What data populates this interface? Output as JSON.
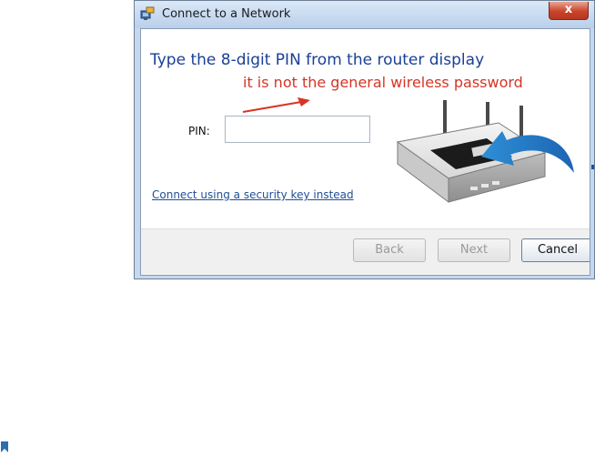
{
  "window": {
    "title": "Connect to a Network",
    "close_symbol": "x"
  },
  "content": {
    "heading": "Type the 8-digit PIN from the router display",
    "note": "it is not the general wireless password",
    "pin_label": "PIN:",
    "pin_value": "",
    "pin_placeholder": "",
    "link": "Connect using a security key instead"
  },
  "buttons": {
    "back": "Back",
    "next": "Next",
    "cancel": "Cancel"
  },
  "icons": {
    "window_icon": "network-icon",
    "close_icon": "close-icon",
    "arrow_icon": "red-arrow-icon",
    "router": "router-illustration",
    "page_bookmark": "bookmark-icon"
  },
  "colors": {
    "heading": "#1a3f97",
    "note": "#d63426",
    "link": "#1f4f99",
    "close_button": "#c9442b"
  }
}
